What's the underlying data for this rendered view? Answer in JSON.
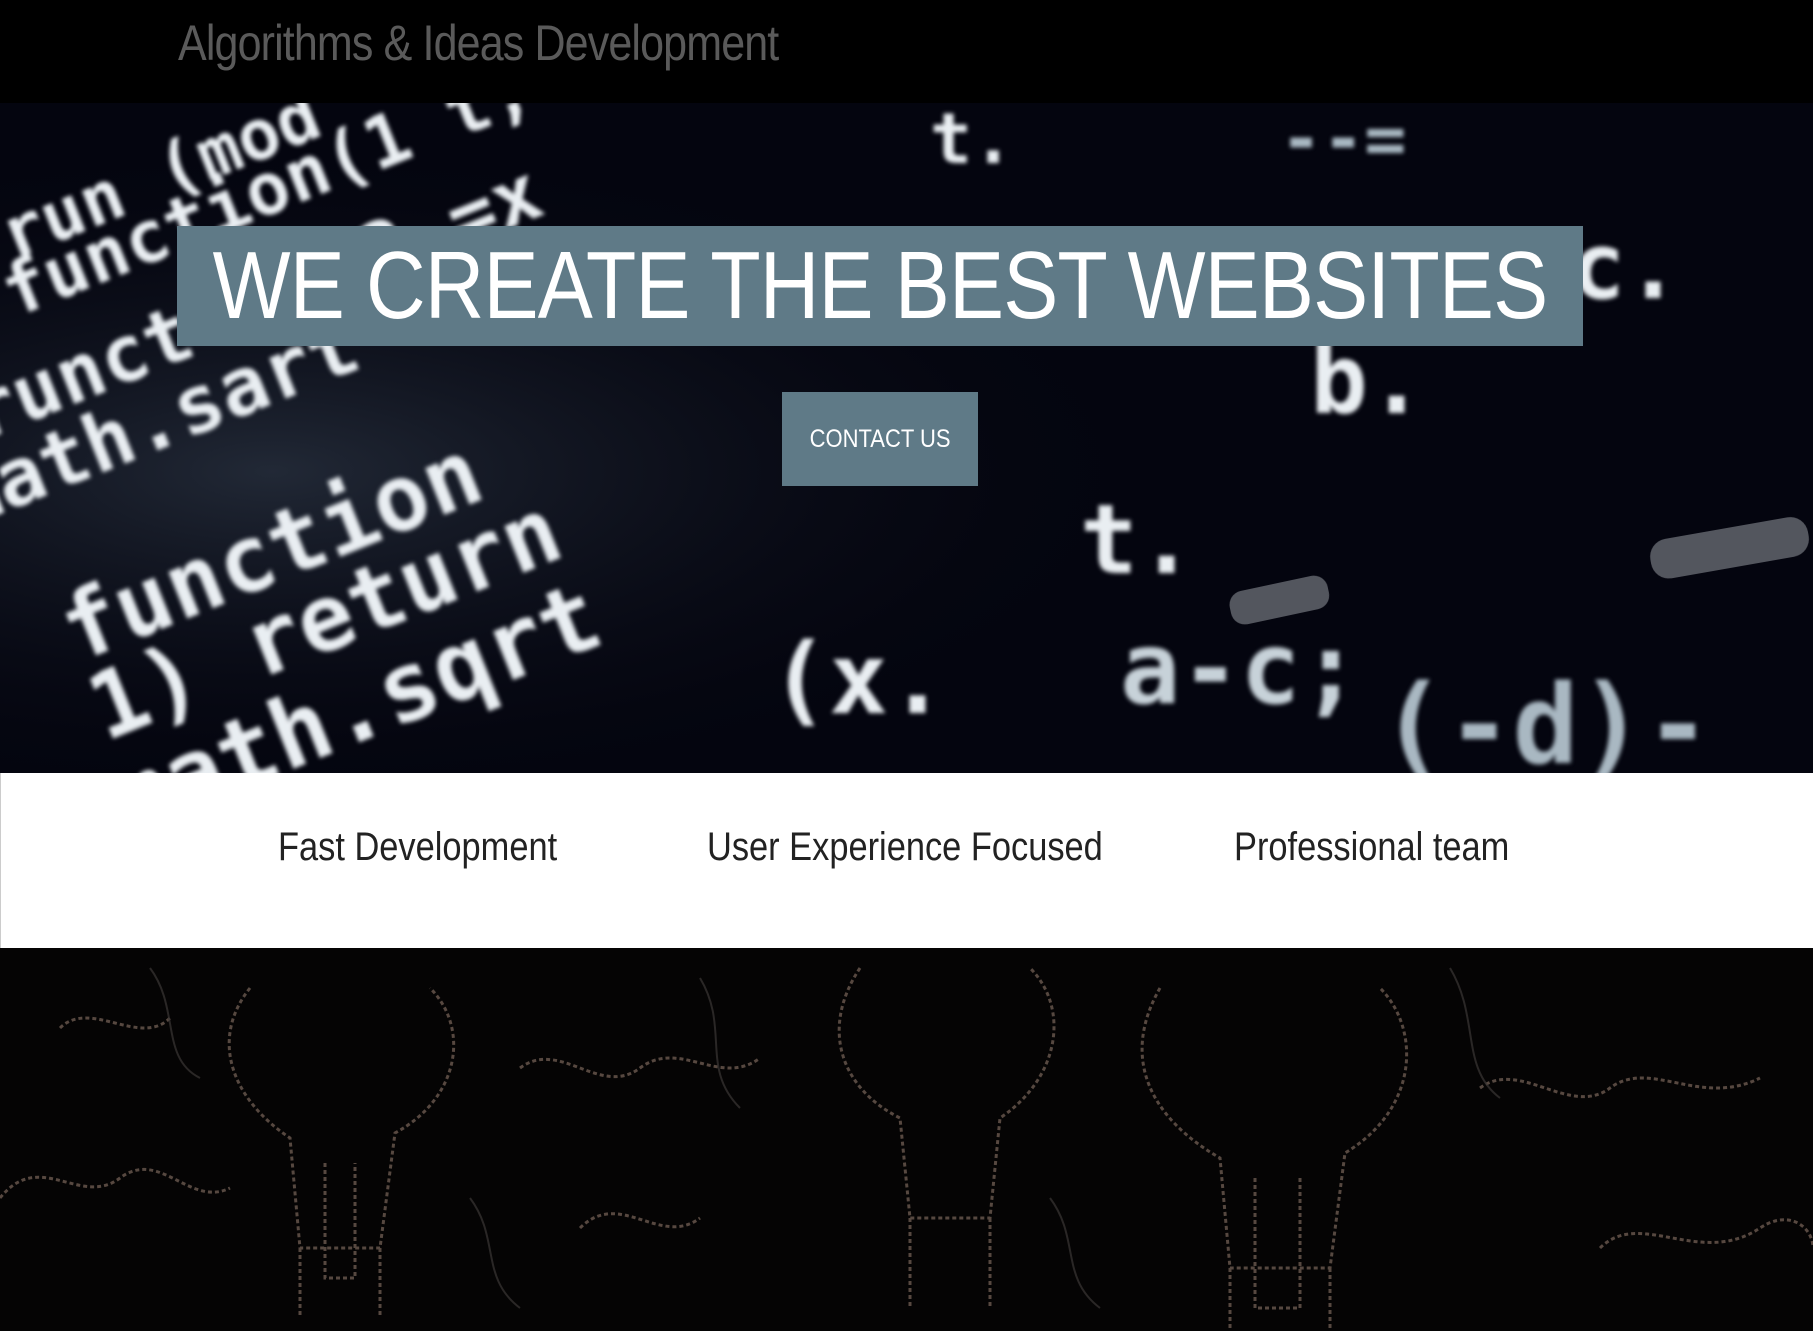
{
  "header": {
    "brand": "Algorithms & Ideas Development"
  },
  "hero": {
    "headline": "WE CREATE THE BEST WEBSITES",
    "contact_label": "CONTACT US"
  },
  "features": [
    {
      "label": "Fast Development"
    },
    {
      "label": "User Experience Focused"
    },
    {
      "label": "Professional team"
    }
  ],
  "colors": {
    "accent": "#5f7a87",
    "background": "#000000",
    "hero_bg": "#04050f",
    "feature_bg": "#ffffff"
  }
}
